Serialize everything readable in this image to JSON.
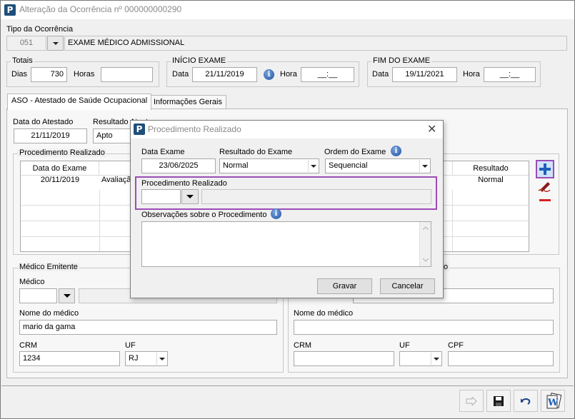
{
  "window": {
    "title": "Alteração da Ocorrência nº 000000000290",
    "app_icon": "P"
  },
  "tipo": {
    "label": "Tipo da Ocorrência",
    "code": "051",
    "description": "EXAME MÉDICO ADMISSIONAL"
  },
  "totais": {
    "legend": "Totais",
    "dias_label": "Dias",
    "dias_value": "730",
    "horas_label": "Horas",
    "horas_value": ""
  },
  "inicio": {
    "legend": "INÍCIO EXAME",
    "data_label": "Data",
    "data_value": "21/11/2019",
    "hora_label": "Hora",
    "hora_value": "__:__"
  },
  "fim": {
    "legend": "FIM DO EXAME",
    "data_label": "Data",
    "data_value": "19/11/2021",
    "hora_label": "Hora",
    "hora_value": "__:__"
  },
  "tabs": [
    {
      "label": "ASO - Atestado de Saúde Ocupacional",
      "active": true
    },
    {
      "label": "Informações Gerais",
      "active": false
    }
  ],
  "aso": {
    "data_atestado_label": "Data do Atestado",
    "data_atestado_value": "21/11/2019",
    "resultado_label": "Resultado Atest",
    "resultado_value": "Apto",
    "procedimento_legend": "Procedimento Realizado",
    "grid": {
      "columns": [
        "Data do Exame",
        "Resultado"
      ],
      "row": {
        "data": "20/11/2019",
        "proc": "Avaliaçã",
        "resultado": "Normal"
      }
    }
  },
  "medico_emitente": {
    "legend": "Médico Emitente",
    "medico_label": "Médico",
    "nome_label": "Nome do médico",
    "nome_value": "mario da gama",
    "crm_label": "CRM",
    "crm_value": "1234",
    "uf_label": "UF",
    "uf_value": "RJ"
  },
  "medico_responsavel": {
    "legend": "o",
    "nome_label": "Nome do médico",
    "crm_label": "CRM",
    "uf_label": "UF",
    "cpf_label": "CPF"
  },
  "dialog": {
    "title": "Procedimento Realizado",
    "data_exame_label": "Data Exame",
    "data_exame_value": "23/06/2025",
    "resultado_label": "Resultado do Exame",
    "resultado_value": "Normal",
    "ordem_label": "Ordem do Exame",
    "ordem_value": "Sequencial",
    "proc_label": "Procedimento Realizado",
    "obs_label": "Observações sobre o Procedimento",
    "save_label": "Gravar",
    "cancel_label": "Cancelar"
  },
  "colors": {
    "selection": "#1e7ae6",
    "highlight_border": "#9b4db5",
    "brand": "#1f4f7a"
  },
  "icons": [
    "add-icon",
    "edit-icon",
    "remove-icon",
    "next-icon",
    "save-icon",
    "undo-icon",
    "document-icon",
    "info-icon",
    "close-icon"
  ]
}
